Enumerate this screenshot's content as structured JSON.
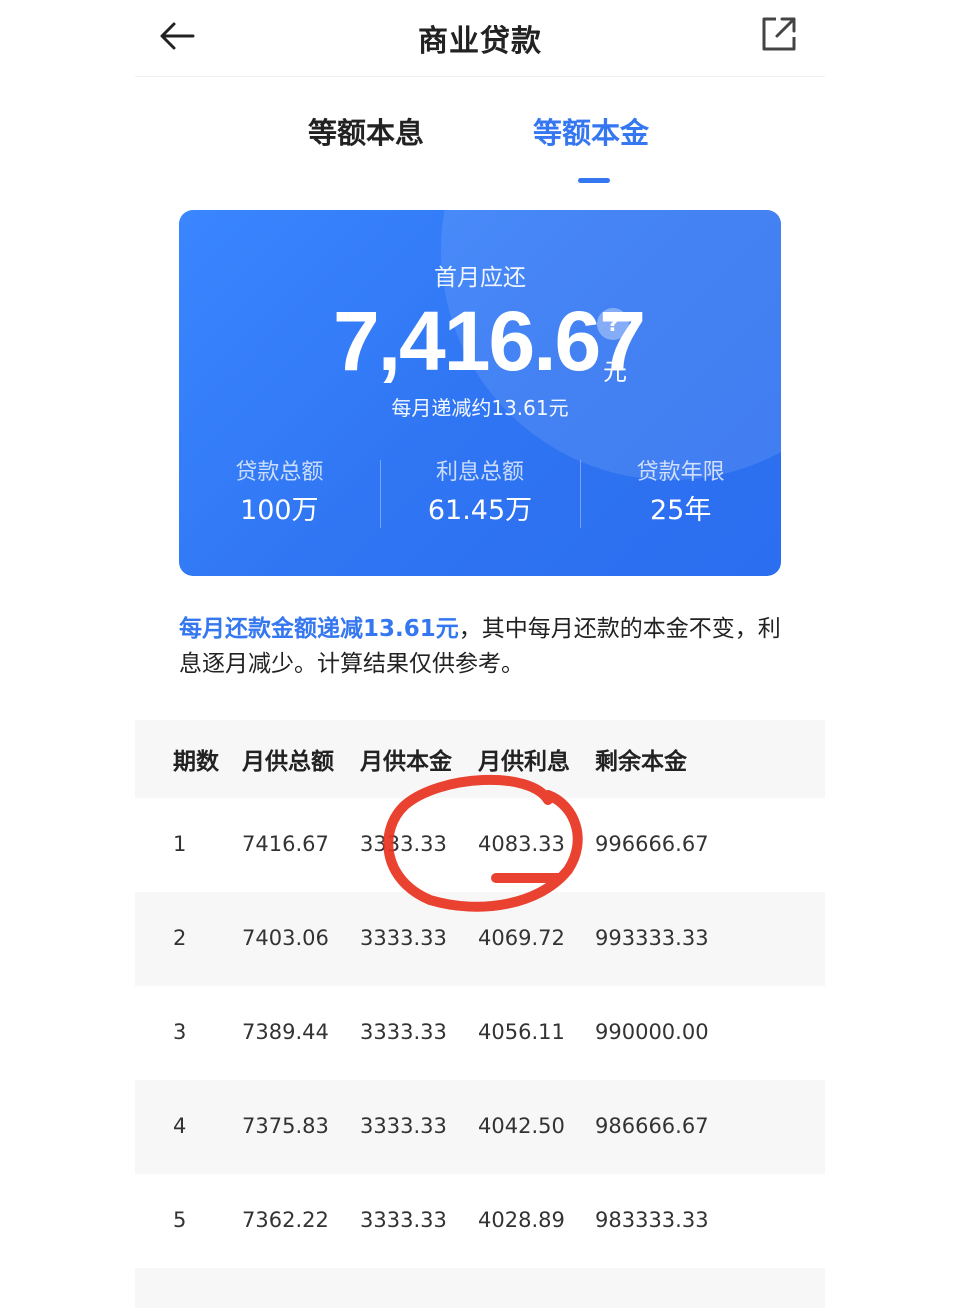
{
  "header": {
    "title": "商业贷款"
  },
  "tabs": [
    {
      "label": "等额本息",
      "active": false
    },
    {
      "label": "等额本金",
      "active": true
    }
  ],
  "summary": {
    "label": "首月应还",
    "amount": "7,416.67",
    "help": "?",
    "unit": "元",
    "subtext": "每月递减约13.61元",
    "stats": [
      {
        "label": "贷款总额",
        "value": "100万"
      },
      {
        "label": "利息总额",
        "value": "61.45万"
      },
      {
        "label": "贷款年限",
        "value": "25年"
      }
    ]
  },
  "note": {
    "highlight": "每月还款金额递减13.61元",
    "rest": "，其中每月还款的本金不变，利息逐月减少。计算结果仅供参考。"
  },
  "table": {
    "headers": [
      "期数",
      "月供总额",
      "月供本金",
      "月供利息",
      "剩余本金"
    ],
    "rows": [
      [
        "1",
        "7416.67",
        "3333.33",
        "4083.33",
        "996666.67"
      ],
      [
        "2",
        "7403.06",
        "3333.33",
        "4069.72",
        "993333.33"
      ],
      [
        "3",
        "7389.44",
        "3333.33",
        "4056.11",
        "990000.00"
      ],
      [
        "4",
        "7375.83",
        "3333.33",
        "4042.50",
        "986666.67"
      ],
      [
        "5",
        "7362.22",
        "3333.33",
        "4028.89",
        "983333.33"
      ]
    ]
  },
  "colors": {
    "accent": "#3477f0",
    "card": "#2f74f2",
    "annotation": "#e8321e"
  },
  "icons": {
    "back": "arrow-left-icon",
    "share": "share-external-icon",
    "help": "question-circle-icon"
  }
}
